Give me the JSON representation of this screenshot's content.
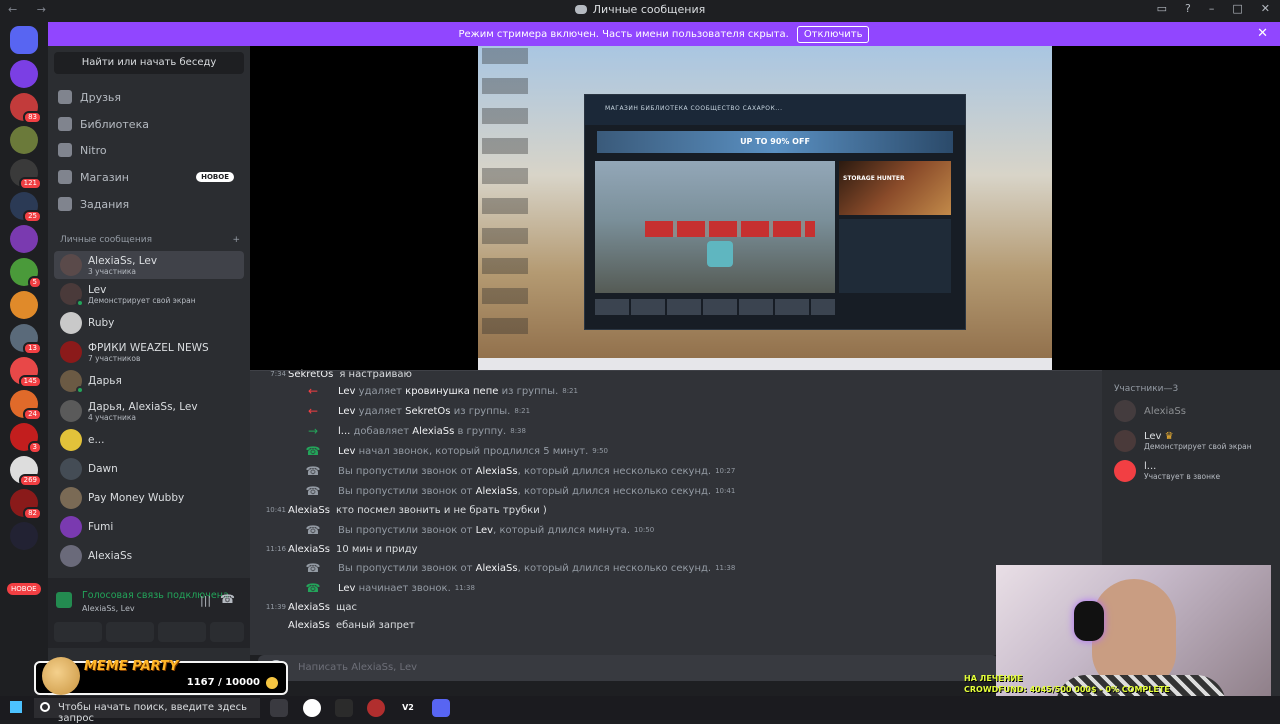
{
  "window": {
    "title": "Личные сообщения",
    "nav": "← →"
  },
  "banner": {
    "text": "Режим стримера включен. Часть имени пользователя скрыта.",
    "button": "Отключить",
    "close": "✕"
  },
  "servers": [
    {
      "badge": ""
    },
    {
      "badge": "83"
    },
    {
      "badge": ""
    },
    {
      "badge": "121"
    },
    {
      "badge": "25"
    },
    {
      "badge": ""
    },
    {
      "badge": "5"
    },
    {
      "badge": ""
    },
    {
      "badge": "13"
    },
    {
      "badge": "145"
    },
    {
      "badge": "24"
    },
    {
      "badge": "3"
    },
    {
      "badge": "269"
    },
    {
      "badge": "82"
    },
    {
      "badge": ""
    }
  ],
  "new_pill": "НОВОЕ",
  "sidebar": {
    "search": "Найти или начать беседу",
    "nav": [
      {
        "label": "Друзья"
      },
      {
        "label": "Библиотека"
      },
      {
        "label": "Nitro"
      },
      {
        "label": "Магазин",
        "badge": "НОВОЕ"
      },
      {
        "label": "Задания"
      }
    ],
    "dm_header": "Личные сообщения",
    "dm_add": "+",
    "dms": [
      {
        "name": "AlexiaSs, Lev",
        "sub": "3 участника",
        "color": "#5a4a4a"
      },
      {
        "name": "Lev",
        "sub": "Демонстрирует свой экран",
        "color": "#4a3a3a"
      },
      {
        "name": "Ruby",
        "sub": "",
        "color": "#c9c9c9"
      },
      {
        "name": "ФРИКИ WEAZEL NEWS",
        "sub": "7 участников",
        "color": "#8b1a1a"
      },
      {
        "name": "Дарья",
        "sub": "",
        "color": "#6b5a44"
      },
      {
        "name": "Дарья, AlexiaSs, Lev",
        "sub": "4 участника",
        "color": "#5a5a5a"
      },
      {
        "name": "e...",
        "sub": "",
        "color": "#e2c23a"
      },
      {
        "name": "Dawn",
        "sub": "",
        "color": "#444c55"
      },
      {
        "name": "Pay Money Wubby",
        "sub": "",
        "color": "#7a6a55"
      },
      {
        "name": "Fumi",
        "sub": "",
        "color": "#7a3ab0"
      },
      {
        "name": "AlexiaSs",
        "sub": "",
        "color": "#6a6a7a"
      }
    ]
  },
  "voice": {
    "status": "Голосовая связь подключена",
    "channel": "AlexiaSs, Lev"
  },
  "members": {
    "header": "Участники—3",
    "list": [
      {
        "name": "AlexiaSs",
        "sub": ""
      },
      {
        "name": "Lev",
        "sub": "Демонстрирует свой экран",
        "crown": "♛"
      },
      {
        "name": "l...",
        "sub": "Участвует в звонке"
      }
    ]
  },
  "messages": [
    {
      "time": "7:34",
      "author": "SekretOs",
      "body": "я настраиваю"
    },
    {
      "kind": "leave",
      "actor": "Lev",
      "verb": "удаляет",
      "target": "кровинушка пепе",
      "tail": "из группы.",
      "ts": "8:21"
    },
    {
      "kind": "leave",
      "actor": "Lev",
      "verb": "удаляет",
      "target": "SekretOs",
      "tail": "из группы.",
      "ts": "8:21"
    },
    {
      "kind": "join",
      "actor": "l...",
      "verb": "добавляет",
      "target": "AlexiaSs",
      "tail": "в группу.",
      "ts": "8:38"
    },
    {
      "kind": "call",
      "actor": "Lev",
      "verb": "начал звонок, который продлился 5 минут.",
      "ts": "9:50"
    },
    {
      "kind": "missed",
      "pre": "Вы пропустили звонок от",
      "actor": "AlexiaSs",
      "tail": ", который длился несколько секунд.",
      "ts": "10:27"
    },
    {
      "kind": "missed",
      "pre": "Вы пропустили звонок от",
      "actor": "AlexiaSs",
      "tail": ", который длился несколько секунд.",
      "ts": "10:41"
    },
    {
      "time": "10:41",
      "author": "AlexiaSs",
      "body": "кто посмел звонить и не брать трубки )"
    },
    {
      "kind": "missed",
      "pre": "Вы пропустили звонок от",
      "actor": "Lev",
      "tail": ", который длился минута.",
      "ts": "10:50"
    },
    {
      "time": "11:16",
      "author": "AlexiaSs",
      "body": "10 мин и приду"
    },
    {
      "kind": "missed",
      "pre": "Вы пропустили звонок от",
      "actor": "AlexiaSs",
      "tail": ", который длился несколько секунд.",
      "ts": "11:38"
    },
    {
      "kind": "call",
      "actor": "Lev",
      "verb": "начинает звонок.",
      "ts": "11:38"
    },
    {
      "time": "11:39",
      "author": "AlexiaSs",
      "body": "щас"
    },
    {
      "time": "",
      "author": "AlexiaSs",
      "body": "ебаный запрет"
    }
  ],
  "composer": {
    "placeholder": "Написать AlexiaSs, Lev"
  },
  "stream": {
    "store_tabs": "МАГАЗИН  БИБЛИОТЕКА  СООБЩЕСТВО  САХАРОК...",
    "promo": "UP TO 90% OFF",
    "cover": "STORAGE HUNTER"
  },
  "overlay": {
    "meme_label": "MEME PARTY",
    "meme_count": "1167 / 10000",
    "cam_line1": "НА ЛЕЧЕНИЕ",
    "cam_line2": "CROWDFUND: 4045/500 000$ - 0% COMPLETE",
    "progress": 0.01
  },
  "taskbar": {
    "search": "Чтобы начать поиск, введите здесь запрос",
    "v2": "V2"
  },
  "colors": {
    "blurple": "#5865f2",
    "streamer": "#9146ff",
    "green": "#23a55a",
    "red": "#f23f43"
  }
}
